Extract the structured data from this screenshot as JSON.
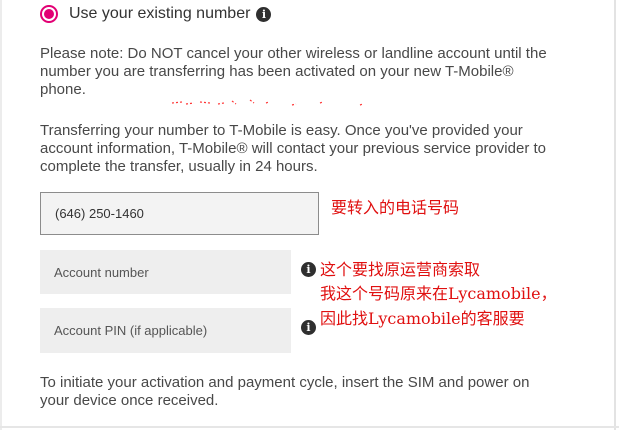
{
  "option": {
    "label": "Use your existing number",
    "selected": true,
    "accent_color": "#e20074",
    "icon": "info-icon"
  },
  "note_paragraph": "Please note: Do NOT cancel your other wireless or landline account until the number you are transferring has been activated on your new T-Mobile® phone.",
  "info_paragraph": "Transferring your number to T-Mobile is easy. Once you've provided your account information, T-Mobile® will contact your previous service provider to complete the transfer, usually in 24 hours.",
  "fields": {
    "phone_value": "(646) 250-1460",
    "account_number_placeholder": "Account number",
    "account_pin_placeholder": "Account PIN (if applicable)"
  },
  "annotations": {
    "color": "#e01010",
    "phone_note": "要转入的电话号码",
    "line1": "这个要找原运营商索取",
    "line2": "我这个号码原来在Lycamobile，",
    "line3": "因此找Lycamobile的客服要"
  },
  "footer_paragraph": "To initiate your activation and payment cycle, insert the SIM and power on your device once received.",
  "info_glyph": "i"
}
